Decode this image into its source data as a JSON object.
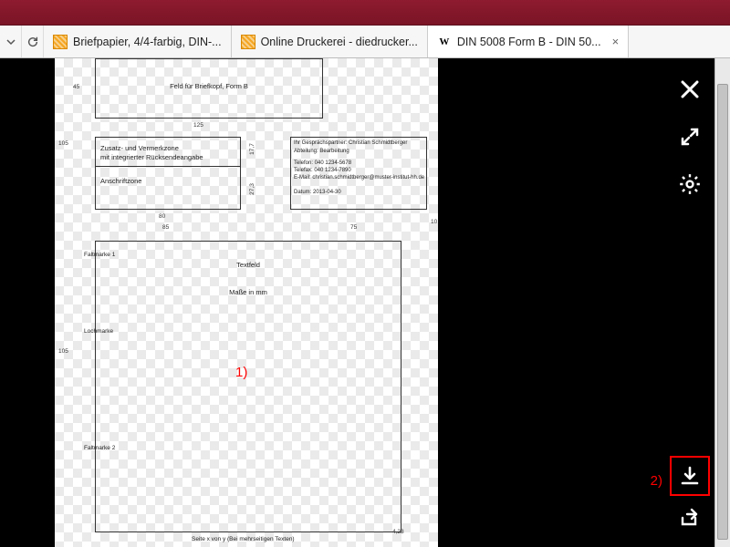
{
  "tabs": [
    {
      "label": "Briefpapier, 4/4-farbig, DIN-..."
    },
    {
      "label": "Online Druckerei - diedrucker..."
    },
    {
      "label": "DIN 5008 Form B - DIN 50..."
    }
  ],
  "document": {
    "header_label": "Feld für Briefkopf, Form B",
    "zusatz_line1": "Zusatz- und Vermerkzone",
    "zusatz_line2": "mit integrierter Rücksendeangabe",
    "anschrift_label": "Anschriftzone",
    "info_line1": "Ihr Gesprächspartner: Christian Schmidtberger",
    "info_line2": "Abteilung: Bearbeitung",
    "info_line3": "Telefon: 040 1234-5678",
    "info_line4": "Telefax: 040 1234-7890",
    "info_line5": "E-Mail: christian.schmidtberger@muster-institut-hh.de",
    "info_line6": "Datum: 2013-04-30",
    "textfeld_label": "Textfeld",
    "masse_label": "Maße in mm",
    "faltmarke1": "Faltmarke 1",
    "faltmarke2": "Faltmarke 2",
    "lochmarke": "Lochmarke",
    "footer": "Seite x von y (Bei mehrseitigen Texten)",
    "dims": {
      "d45": "45",
      "d125": "125",
      "d105_top": "105",
      "d80": "80",
      "d85": "85",
      "d75": "75",
      "d17_7": "17,7",
      "d27_3": "27,3",
      "d10": "10",
      "d4_23": "4,23",
      "d105_bottom": "105"
    }
  },
  "annotations": {
    "one": "1)",
    "two": "2)"
  },
  "actions": {
    "close": "close-icon",
    "fullscreen": "fullscreen-icon",
    "settings": "gear-icon",
    "download": "download-icon",
    "share": "share-icon"
  }
}
